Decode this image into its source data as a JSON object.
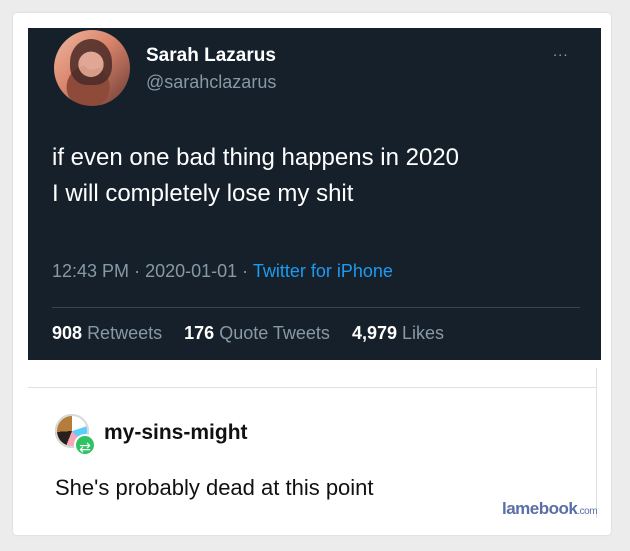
{
  "tweet": {
    "display_name": "Sarah Lazarus",
    "handle": "@sarahclazarus",
    "more_icon": "...",
    "text_line1": "if even one bad thing happens in 2020",
    "text_line2": "I will completely lose my shit",
    "time": "12:43 PM",
    "date": "2020-01-01",
    "source": "Twitter for iPhone",
    "separator": "·",
    "stats": {
      "retweets_count": "908",
      "retweets_label": "Retweets",
      "quotes_count": "176",
      "quotes_label": "Quote Tweets",
      "likes_count": "4,979",
      "likes_label": "Likes"
    }
  },
  "reply": {
    "username": "my-sins-might",
    "text": "She's probably dead at this point",
    "reblog_icon": "⇄"
  },
  "watermark": {
    "brand": "lamebook",
    "suffix": ".com"
  }
}
